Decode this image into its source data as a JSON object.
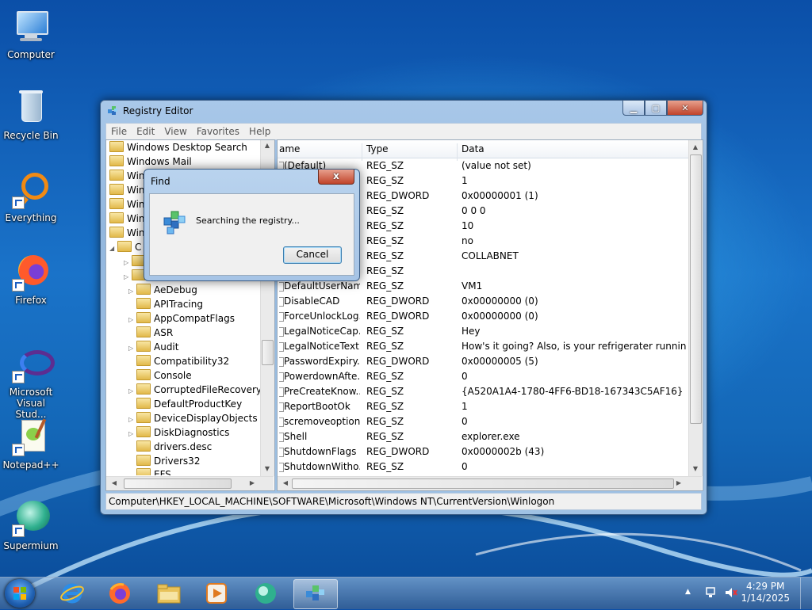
{
  "desktop": {
    "icons": [
      {
        "label": "Computer"
      },
      {
        "label": "Recycle Bin"
      },
      {
        "label": "Everything"
      },
      {
        "label": "Firefox"
      },
      {
        "label": "Microsoft Visual Stud..."
      },
      {
        "label": "Notepad++"
      },
      {
        "label": "Supermium"
      }
    ]
  },
  "window": {
    "title": "Registry Editor",
    "buttons": {
      "minimize": "▁",
      "maximize": "▢",
      "close": "✕"
    },
    "menu": [
      "File",
      "Edit",
      "View",
      "Favorites",
      "Help"
    ],
    "tree": {
      "top_items": [
        "Windows Desktop Search",
        "Windows Mail",
        "Win",
        "Win",
        "Win",
        "Win",
        "Win"
      ],
      "partial_item": "C",
      "child_items": [
        "AeDebug",
        "APITracing",
        "AppCompatFlags",
        "ASR",
        "Audit",
        "Compatibility32",
        "Console",
        "CorruptedFileRecovery",
        "DefaultProductKey",
        "DeviceDisplayObjects",
        "DiskDiagnostics",
        "drivers.desc",
        "Drivers32",
        "EFS"
      ]
    },
    "list": {
      "columns": {
        "name": "ame",
        "type": "Type",
        "data": "Data"
      },
      "rows": [
        {
          "name": "(Default)",
          "type": "REG_SZ",
          "data": "(value not set)"
        },
        {
          "name": "h",
          "type": "REG_SZ",
          "data": "1"
        },
        {
          "name": "",
          "type": "REG_DWORD",
          "data": "0x00000001 (1)"
        },
        {
          "name": "",
          "type": "REG_SZ",
          "data": "0 0 0"
        },
        {
          "name": "",
          "type": "REG_SZ",
          "data": "10"
        },
        {
          "name": "",
          "type": "REG_SZ",
          "data": "no"
        },
        {
          "name": "",
          "type": "REG_SZ",
          "data": "COLLABNET"
        },
        {
          "name": "",
          "type": "REG_SZ",
          "data": ""
        },
        {
          "name": "DefaultUserName",
          "type": "REG_SZ",
          "data": "VM1"
        },
        {
          "name": "DisableCAD",
          "type": "REG_DWORD",
          "data": "0x00000000 (0)"
        },
        {
          "name": "ForceUnlockLog...",
          "type": "REG_DWORD",
          "data": "0x00000000 (0)"
        },
        {
          "name": "LegalNoticeCap...",
          "type": "REG_SZ",
          "data": "Hey"
        },
        {
          "name": "LegalNoticeText",
          "type": "REG_SZ",
          "data": "How's it going? Also, is your refrigerater running? I..."
        },
        {
          "name": "PasswordExpiry...",
          "type": "REG_DWORD",
          "data": "0x00000005 (5)"
        },
        {
          "name": "PowerdownAfte...",
          "type": "REG_SZ",
          "data": "0"
        },
        {
          "name": "PreCreateKnow...",
          "type": "REG_SZ",
          "data": "{A520A1A4-1780-4FF6-BD18-167343C5AF16}"
        },
        {
          "name": "ReportBootOk",
          "type": "REG_SZ",
          "data": "1"
        },
        {
          "name": "scremoveoption",
          "type": "REG_SZ",
          "data": "0"
        },
        {
          "name": "Shell",
          "type": "REG_SZ",
          "data": "explorer.exe"
        },
        {
          "name": "ShutdownFlags",
          "type": "REG_DWORD",
          "data": "0x0000002b (43)"
        },
        {
          "name": "ShutdownWitho...",
          "type": "REG_SZ",
          "data": "0"
        }
      ]
    },
    "status_path": "Computer\\HKEY_LOCAL_MACHINE\\SOFTWARE\\Microsoft\\Windows NT\\CurrentVersion\\Winlogon"
  },
  "find_dialog": {
    "title": "Find",
    "close": "x",
    "message": "Searching the registry...",
    "cancel_label": "Cancel"
  },
  "taskbar": {
    "apps": [
      "internet-explorer-icon",
      "firefox-icon",
      "file-explorer-icon",
      "media-player-icon",
      "supermium-icon",
      "registry-editor-icon"
    ],
    "clock_time": "4:29 PM",
    "clock_date": "1/14/2025"
  },
  "colors": {
    "selection": "#3399ff",
    "titlebar": "#a9c8e9",
    "desktop": "#1a73c9"
  }
}
